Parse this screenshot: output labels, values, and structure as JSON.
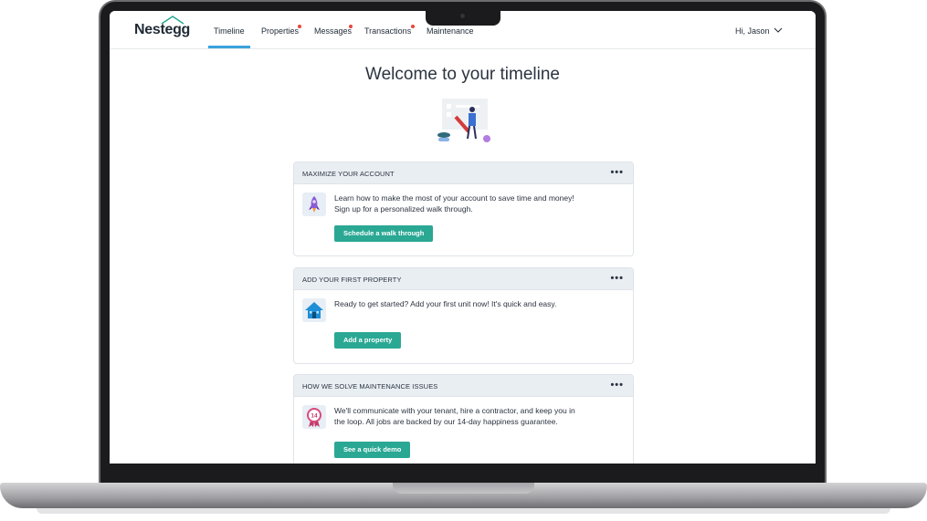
{
  "app": {
    "logo": "Nestegg",
    "nav": [
      {
        "label": "Timeline",
        "active": true,
        "notification": false
      },
      {
        "label": "Properties",
        "active": false,
        "notification": true
      },
      {
        "label": "Messages",
        "active": false,
        "notification": true
      },
      {
        "label": "Transactions",
        "active": false,
        "notification": true
      },
      {
        "label": "Maintenance",
        "active": false,
        "notification": false
      }
    ],
    "user_greeting": "Hi, Jason"
  },
  "main": {
    "title": "Welcome to your timeline",
    "cards": [
      {
        "title": "MAXIMIZE YOUR ACCOUNT",
        "icon": "rocket-icon",
        "text_line1": "Learn how to make the most of your account to save time and money!",
        "text_line2": "Sign up for a personalized walk through.",
        "button": "Schedule a walk through"
      },
      {
        "title": "ADD YOUR FIRST PROPERTY",
        "icon": "house-icon",
        "text_line1": "Ready to get started? Add your first unit now! It's quick and easy.",
        "text_line2": "",
        "button": "Add a property"
      },
      {
        "title": "HOW WE SOLVE MAINTENANCE ISSUES",
        "icon": "guarantee-badge-icon",
        "badge_number": "14",
        "text_line1": "We'll communicate with your tenant, hire a contractor, and keep you in",
        "text_line2": "the loop. All jobs are backed by our 14-day happiness guarantee.",
        "button": "See a quick demo"
      }
    ],
    "more_label": "•••"
  },
  "colors": {
    "accent_button": "#2aa894",
    "nav_underline": "#3aa3dc",
    "notification_dot": "#e8463b",
    "card_header": "#e9eef3"
  }
}
